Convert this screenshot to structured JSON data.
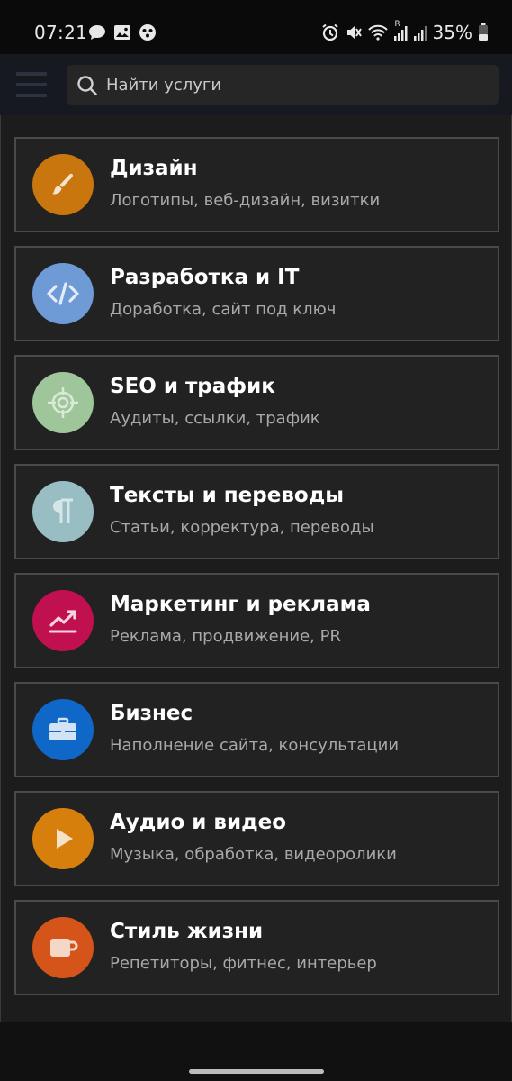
{
  "status_bar": {
    "time": "07:21",
    "left_icons": [
      "chat-bubble-icon",
      "gallery-icon",
      "app-icon"
    ],
    "right_icons": [
      "alarm-icon",
      "mute-icon",
      "wifi-icon",
      "signal-roaming-icon",
      "signal-icon",
      "battery-icon"
    ],
    "roaming_label": "R",
    "battery_percent": "35%"
  },
  "app_bar": {
    "menu_icon": "hamburger-menu-icon",
    "search": {
      "icon": "search-icon",
      "placeholder": "Найти услуги"
    }
  },
  "categories": [
    {
      "title": "Дизайн",
      "subtitle": "Логотипы, веб-дизайн, визитки",
      "icon": "brush-icon",
      "color": "#c9760e"
    },
    {
      "title": "Разработка и IT",
      "subtitle": "Доработка, сайт под ключ",
      "icon": "code-icon",
      "color": "#6e9ad6"
    },
    {
      "title": "SEO и трафик",
      "subtitle": "Аудиты, ссылки, трафик",
      "icon": "target-icon",
      "color": "#9fc59a"
    },
    {
      "title": "Тексты и переводы",
      "subtitle": "Статьи, корректура, переводы",
      "icon": "pilcrow-icon",
      "color": "#98bec4"
    },
    {
      "title": "Маркетинг и реклама",
      "subtitle": "Реклама, продвижение, PR",
      "icon": "trend-up-icon",
      "color": "#c0104f"
    },
    {
      "title": "Бизнес",
      "subtitle": "Наполнение сайта, консультации",
      "icon": "briefcase-icon",
      "color": "#0f67c8"
    },
    {
      "title": "Аудио и видео",
      "subtitle": "Музыка, обработка, видеоролики",
      "icon": "play-icon",
      "color": "#d77f0c"
    },
    {
      "title": "Стиль жизни",
      "subtitle": "Репетиторы, фитнес, интерьер",
      "icon": "mug-icon",
      "color": "#d4541a"
    }
  ]
}
